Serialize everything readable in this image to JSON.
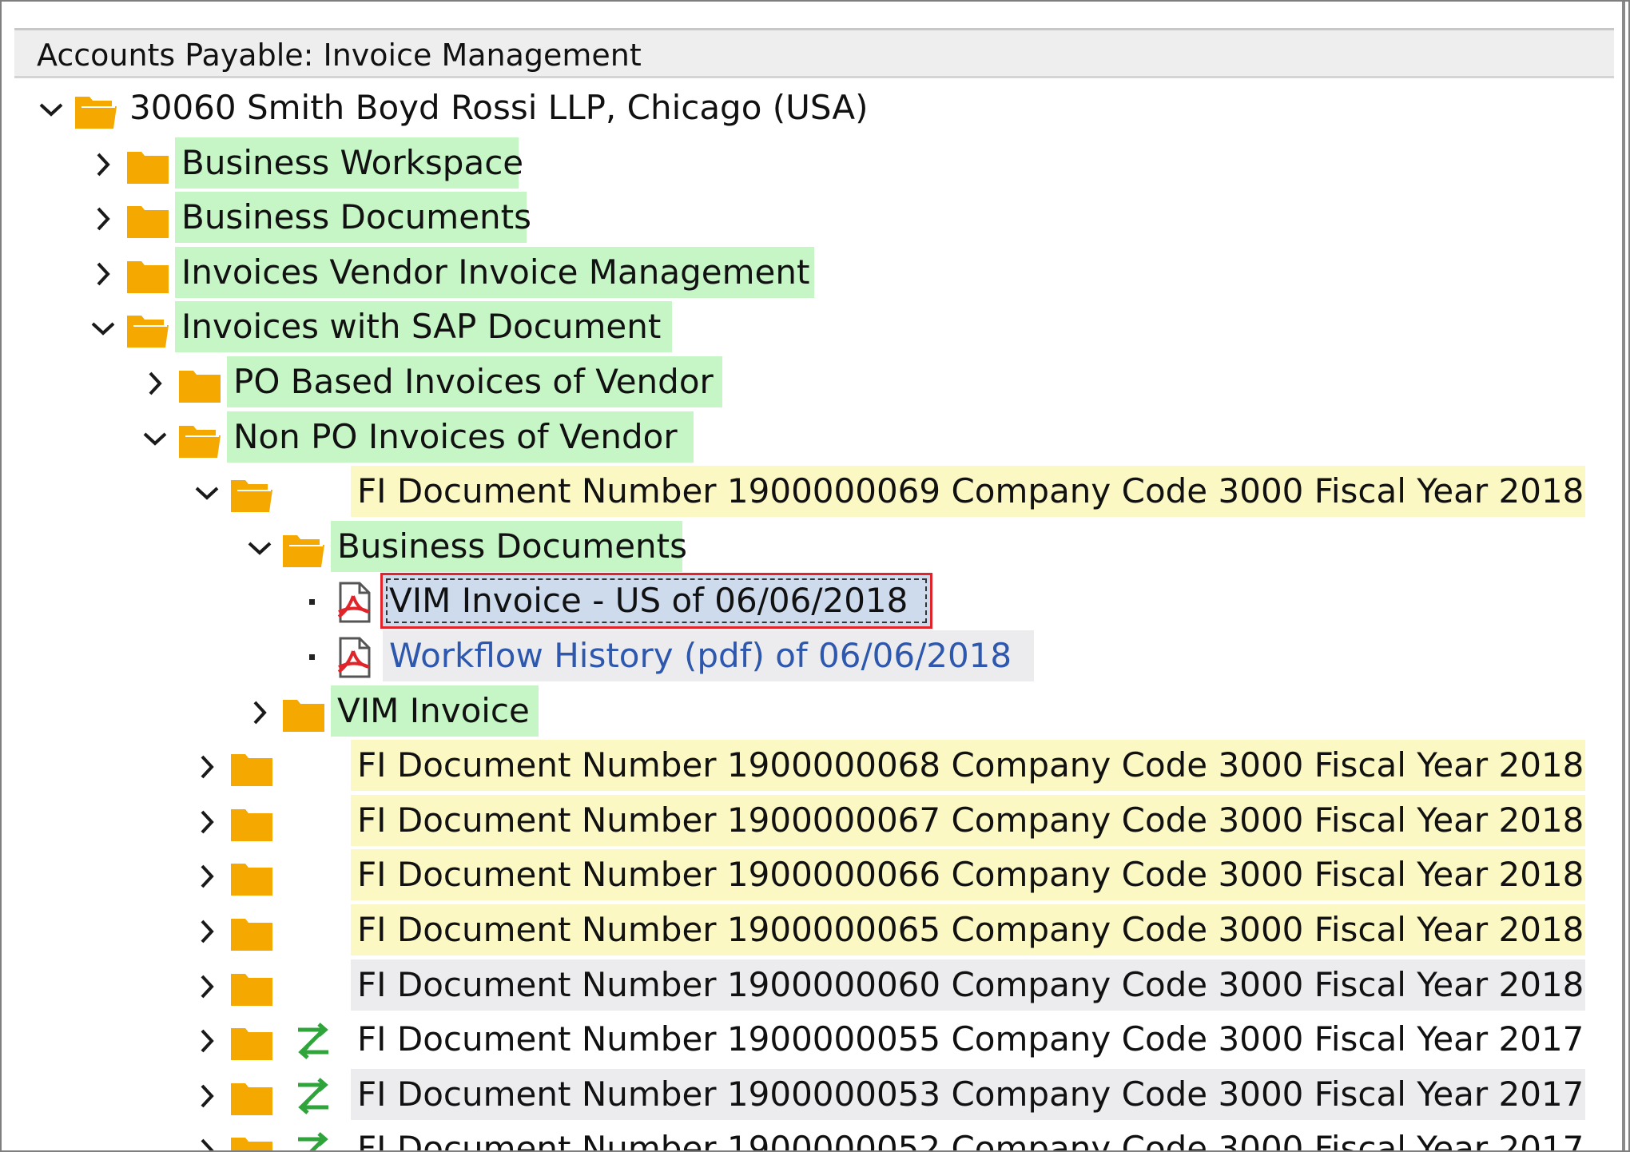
{
  "window": {
    "title": "Accounts Payable: Invoice Management"
  },
  "colors": {
    "folder": "#f5a800",
    "green_highlight": "#c6f5c6",
    "yellow_highlight": "#fbf8c4",
    "gray_highlight": "#ececef",
    "selection": "#cddbed",
    "selection_border": "#e0242a",
    "link": "#2d58ad",
    "workflow_icon": "#2ea43a",
    "pdf_icon": "#e0242a"
  },
  "tree": {
    "nodes": [
      {
        "label": "30060 Smith Boyd Rossi LLP, Chicago (USA)",
        "toggle": "expanded",
        "icon": "folder-open-icon",
        "highlight": "none"
      },
      {
        "label": "Business Workspace",
        "toggle": "collapsed",
        "icon": "folder-icon",
        "highlight": "green"
      },
      {
        "label": "Business Documents",
        "toggle": "collapsed",
        "icon": "folder-icon",
        "highlight": "green"
      },
      {
        "label": "Invoices Vendor Invoice Management",
        "toggle": "collapsed",
        "icon": "folder-icon",
        "highlight": "green"
      },
      {
        "label": "Invoices with SAP Document",
        "toggle": "expanded",
        "icon": "folder-open-icon",
        "highlight": "green"
      },
      {
        "label": "PO Based Invoices of Vendor",
        "toggle": "collapsed",
        "icon": "folder-icon",
        "highlight": "green"
      },
      {
        "label": "Non PO Invoices of Vendor",
        "toggle": "expanded",
        "icon": "folder-open-icon",
        "highlight": "green"
      },
      {
        "label": "FI Document Number 1900000069 Company Code 3000 Fiscal Year 2018",
        "toggle": "expanded",
        "icon": "folder-open-icon",
        "highlight": "yellow"
      },
      {
        "label": "Business Documents",
        "toggle": "expanded",
        "icon": "folder-open-icon",
        "highlight": "green"
      },
      {
        "label": "VIM Invoice - US of 06/06/2018",
        "toggle": "leaf",
        "icon": "pdf-document-icon",
        "highlight": "selected"
      },
      {
        "label": "Workflow History (pdf) of 06/06/2018",
        "toggle": "leaf",
        "icon": "pdf-document-icon",
        "highlight": "gray"
      },
      {
        "label": "VIM Invoice",
        "toggle": "collapsed",
        "icon": "folder-icon",
        "highlight": "green"
      },
      {
        "label": "FI Document Number 1900000068 Company Code 3000 Fiscal Year 2018",
        "toggle": "collapsed",
        "icon": "folder-icon",
        "highlight": "yellow"
      },
      {
        "label": "FI Document Number 1900000067 Company Code 3000 Fiscal Year 2018",
        "toggle": "collapsed",
        "icon": "folder-icon",
        "highlight": "yellow"
      },
      {
        "label": "FI Document Number 1900000066 Company Code 3000 Fiscal Year 2018",
        "toggle": "collapsed",
        "icon": "folder-icon",
        "highlight": "yellow"
      },
      {
        "label": "FI Document Number 1900000065 Company Code 3000 Fiscal Year 2018",
        "toggle": "collapsed",
        "icon": "folder-icon",
        "highlight": "yellow"
      },
      {
        "label": "FI Document Number 1900000060 Company Code 3000 Fiscal Year 2018",
        "toggle": "collapsed",
        "icon": "folder-icon",
        "highlight": "gray"
      },
      {
        "label": "FI Document Number 1900000055 Company Code 3000 Fiscal Year 2017",
        "toggle": "collapsed",
        "icon": "folder-icon",
        "status_icon": "workflow-arrows-icon",
        "highlight": "none"
      },
      {
        "label": "FI Document Number 1900000053 Company Code 3000 Fiscal Year 2017",
        "toggle": "collapsed",
        "icon": "folder-icon",
        "status_icon": "workflow-arrows-icon",
        "highlight": "gray"
      },
      {
        "label": "FI Document Number 1900000052 Company Code 3000 Fiscal Year 2017",
        "toggle": "collapsed",
        "icon": "folder-icon",
        "status_icon": "workflow-arrows-icon",
        "highlight": "none"
      }
    ]
  }
}
